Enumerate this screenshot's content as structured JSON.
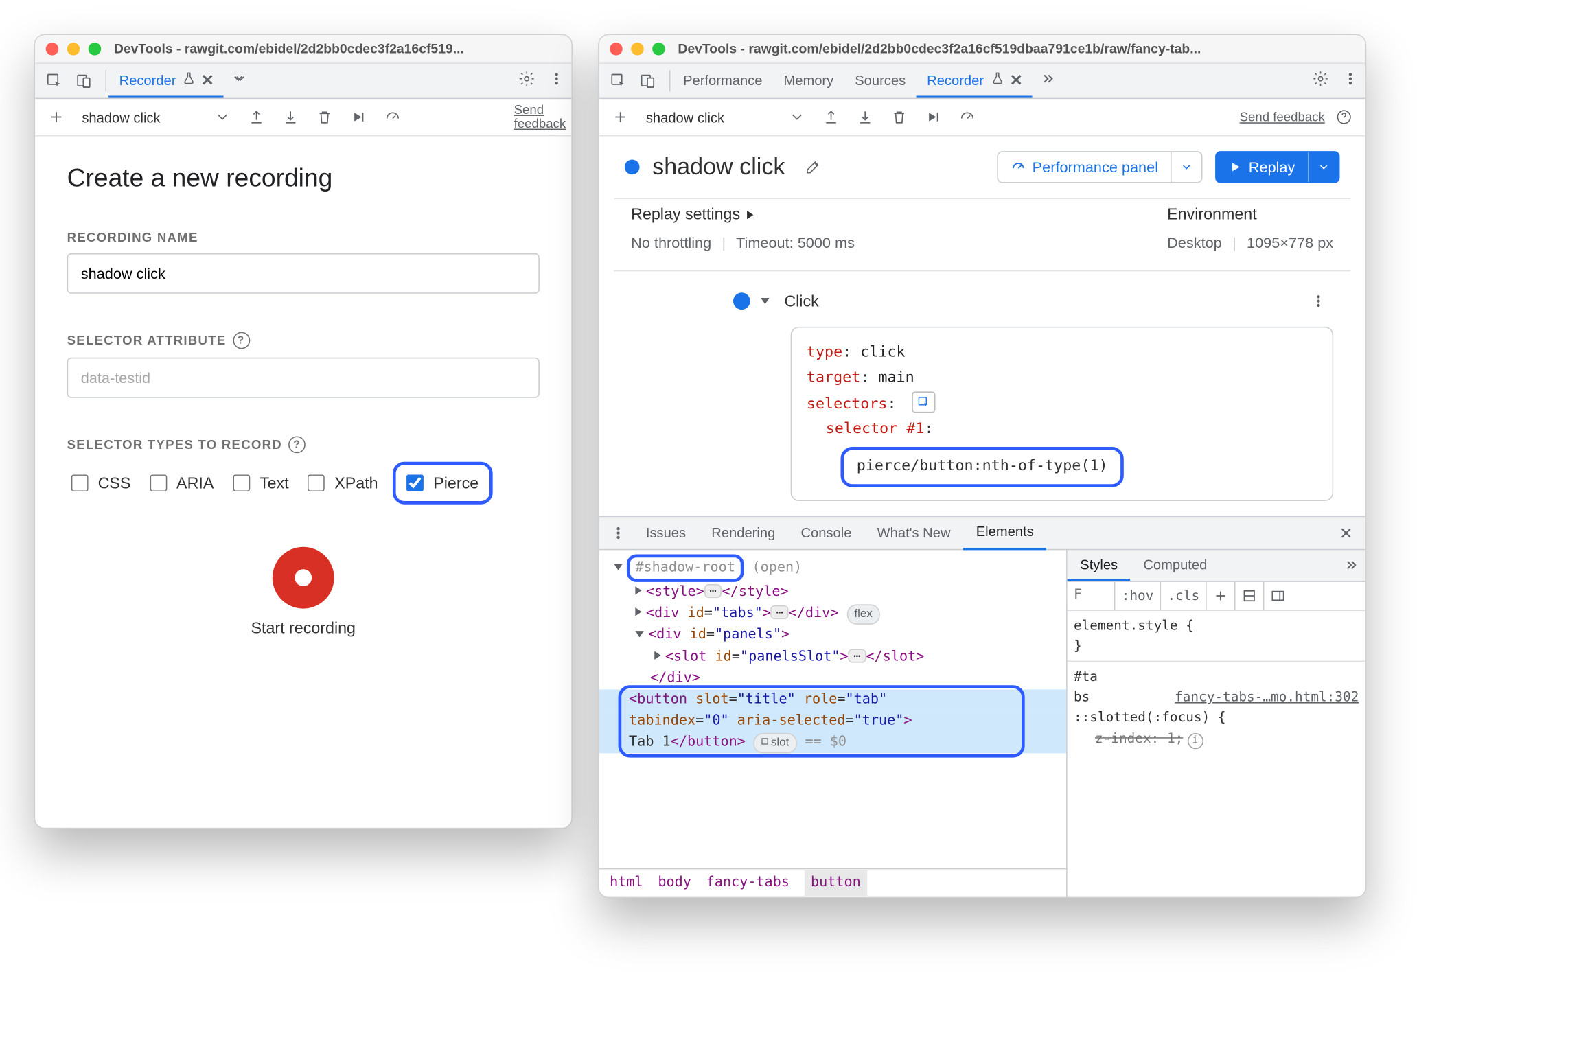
{
  "left": {
    "window_title": "DevTools - rawgit.com/ebidel/2d2bb0cdec3f2a16cf519...",
    "tabs": {
      "recorder": "Recorder"
    },
    "toolbar": {
      "recording_name": "shadow click",
      "send_feedback": "Send feedback"
    },
    "page_title": "Create a new recording",
    "labels": {
      "recording_name": "RECORDING NAME",
      "selector_attribute": "SELECTOR ATTRIBUTE",
      "selector_types": "SELECTOR TYPES TO RECORD"
    },
    "recording_name_value": "shadow click",
    "selector_attr_placeholder": "data-testid",
    "selector_types": {
      "css": "CSS",
      "aria": "ARIA",
      "text": "Text",
      "xpath": "XPath",
      "pierce": "Pierce"
    },
    "start_recording": "Start recording"
  },
  "right": {
    "window_title": "DevTools - rawgit.com/ebidel/2d2bb0cdec3f2a16cf519dbaa791ce1b/raw/fancy-tab...",
    "tabs": {
      "performance": "Performance",
      "memory": "Memory",
      "sources": "Sources",
      "recorder": "Recorder"
    },
    "toolbar": {
      "recording_name": "shadow click",
      "send_feedback": "Send feedback"
    },
    "recording_title": "shadow click",
    "perf_panel": "Performance panel",
    "replay": "Replay",
    "replay_settings_label": "Replay settings",
    "environment_label": "Environment",
    "throttling": "No throttling",
    "timeout": "Timeout: 5000 ms",
    "env_device": "Desktop",
    "env_size": "1095×778 px",
    "step": {
      "title": "Click",
      "type_k": "type",
      "type_v": "click",
      "target_k": "target",
      "target_v": "main",
      "selectors_k": "selectors",
      "selector_num": "selector #1",
      "selector_val": "pierce/button:nth-of-type(1)"
    },
    "drawer": {
      "tabs": {
        "issues": "Issues",
        "rendering": "Rendering",
        "console": "Console",
        "whats_new": "What's New",
        "elements": "Elements"
      },
      "styles_tabs": {
        "styles": "Styles",
        "computed": "Computed"
      },
      "filter_placeholder": "F",
      "hov": ":hov",
      "cls": ".cls",
      "element_style": "element.style {",
      "brace_close": "}",
      "rule_sel": "#ta\nbs",
      "rule_link": "fancy-tabs-…mo.html:302",
      "rule_slotted": "::slotted(:focus) {",
      "zindex_prop": "z-index",
      "zindex_val": "1",
      "dom": {
        "shadow_root": "#shadow-root",
        "open": "(open)",
        "style_open": "<style>",
        "style_close": "</style>",
        "div_tabs_open": "<div id=\"tabs\">",
        "div_tabs_close": "</div>",
        "flex_badge": "flex",
        "div_panels_open": "<div id=\"panels\">",
        "slot_open": "<slot id=\"panelsSlot\">",
        "slot_close": "</slot>",
        "div_close": "</div>",
        "button_l1": "<button slot=\"title\" role=\"tab\"",
        "button_l2": "tabindex=\"0\" aria-selected=\"true\">",
        "button_l3_text": "Tab 1",
        "button_l3_close": "</button>",
        "slot_badge": "slot",
        "eq0": "== $0"
      },
      "breadcrumb": {
        "html": "html",
        "body": "body",
        "fancy": "fancy-tabs",
        "button": "button"
      }
    }
  }
}
